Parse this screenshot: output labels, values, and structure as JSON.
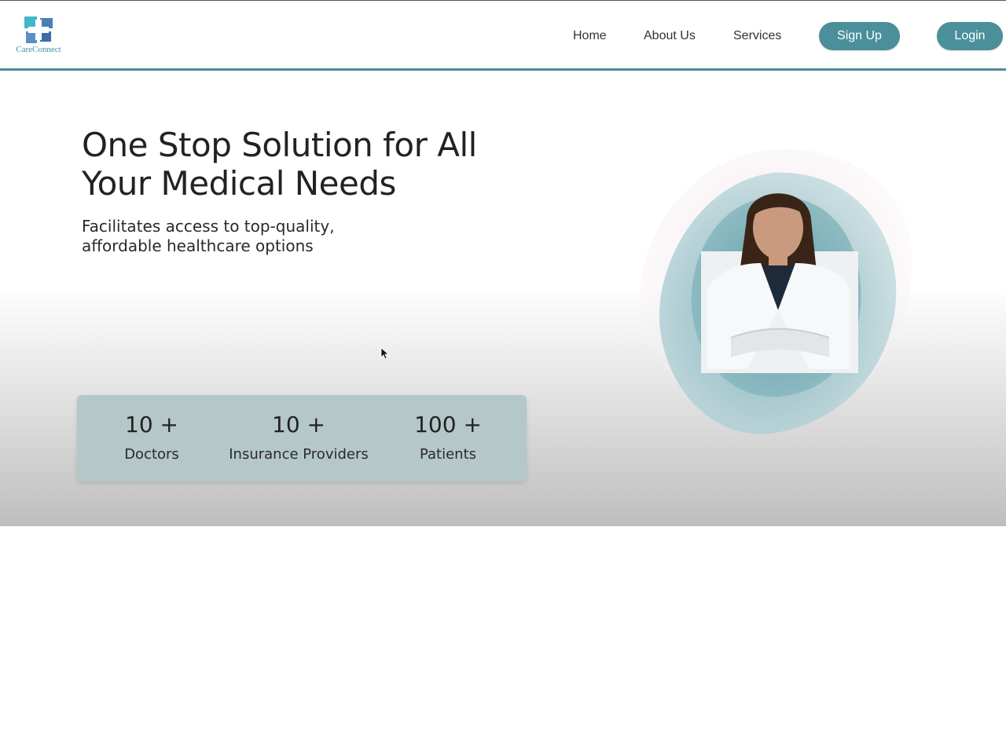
{
  "brand": {
    "name": "CareConnect",
    "logo_icon": "medical-cross-logo",
    "colors": {
      "primary": "#4a8f9a",
      "logo_blue": "#3c8fa0",
      "logo_cyan": "#3fb8c9"
    }
  },
  "nav": {
    "links": [
      "Home",
      "About Us",
      "Services"
    ],
    "signup_label": "Sign Up",
    "login_label": "Login"
  },
  "hero": {
    "title_line1": "One Stop Solution for All",
    "title_line2": "Your Medical Needs",
    "subtitle_line1": "Facilitates access to top-quality,",
    "subtitle_line2": "affordable healthcare options",
    "image_icon": "doctor-portrait-image"
  },
  "stats": [
    {
      "value": "10 +",
      "label": "Doctors"
    },
    {
      "value": "10 +",
      "label": "Insurance Providers"
    },
    {
      "value": "100 +",
      "label": "Patients"
    }
  ]
}
